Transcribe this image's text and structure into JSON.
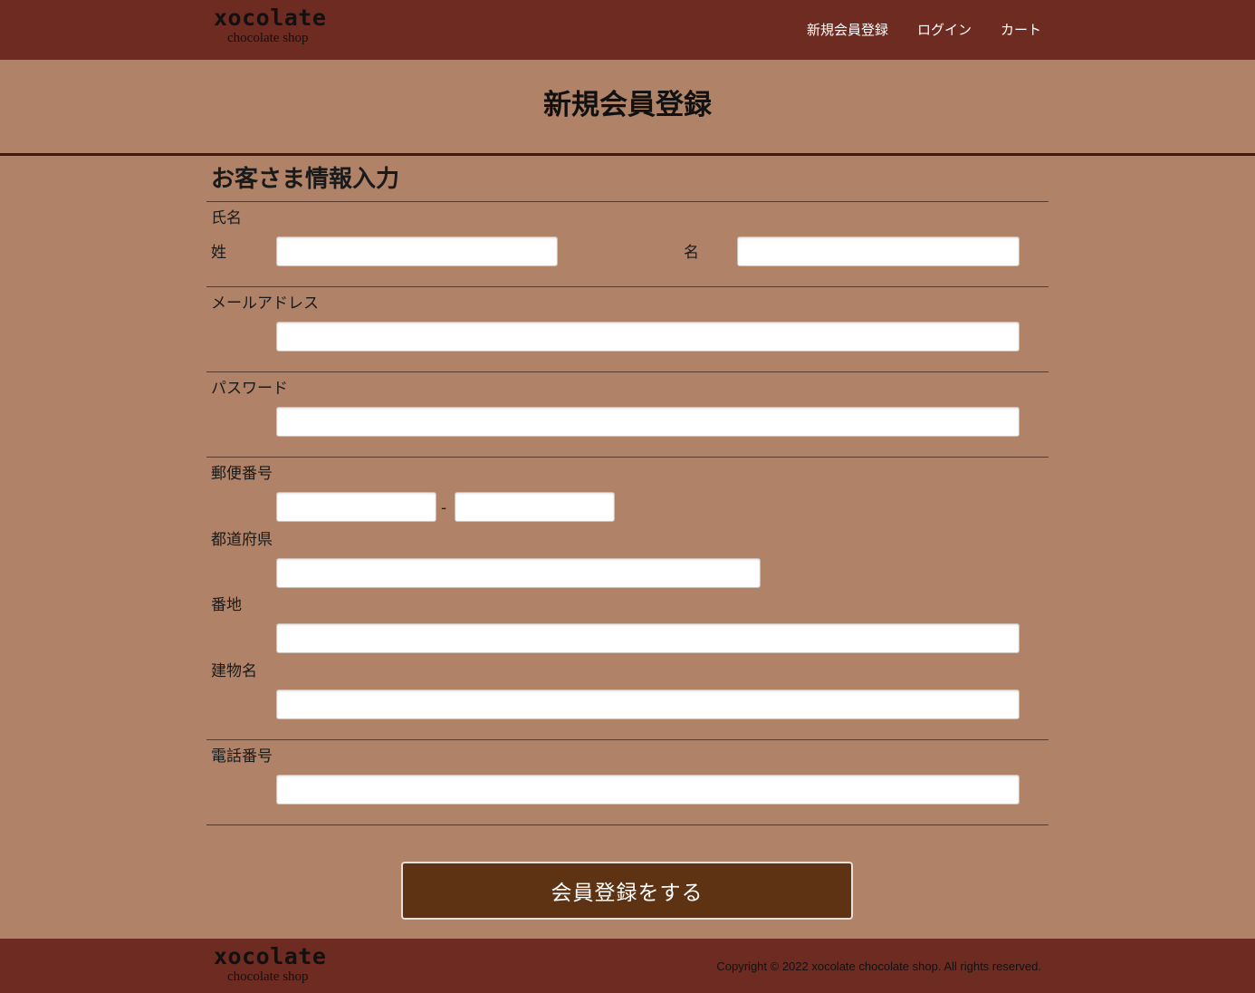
{
  "brand": {
    "name": "xocolate",
    "tagline": "chocolate shop"
  },
  "nav": {
    "register": "新規会員登録",
    "login": "ログイン",
    "cart": "カート"
  },
  "page_title": "新規会員登録",
  "form": {
    "section_title": "お客さま情報入力",
    "name_label": "氏名",
    "last_name_label": "姓",
    "first_name_label": "名",
    "email_label": "メールアドレス",
    "password_label": "パスワード",
    "postal_label": "郵便番号",
    "postal_separator": "-",
    "prefecture_label": "都道府県",
    "address_label": "番地",
    "building_label": "建物名",
    "phone_label": "電話番号",
    "values": {
      "last_name": "",
      "first_name": "",
      "email": "",
      "password": "",
      "postal1": "",
      "postal2": "",
      "prefecture": "",
      "address": "",
      "building": "",
      "phone": ""
    }
  },
  "submit_label": "会員登録をする",
  "footer": {
    "copyright": "Copyright © 2022 xocolate chocolate shop. All rights reserved."
  },
  "colors": {
    "header_bg": "#6e2b22",
    "page_bg": "#b08368",
    "button_bg": "#5e3314"
  }
}
